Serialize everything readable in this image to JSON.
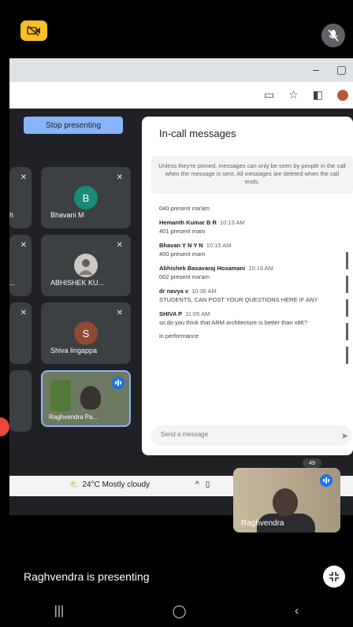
{
  "meeting": {
    "stop_presenting": "Stop presenting",
    "tiles": [
      {
        "name": "Bhavani M",
        "initial": "B",
        "avatar_color": "#1a8a7a"
      },
      {
        "name": "ABHISHEK KU...",
        "initial": "",
        "avatar_color": "#c9c9c9"
      },
      {
        "name": "Shiva lingappa",
        "initial": "S",
        "avatar_color": "#8f4a33"
      }
    ],
    "left_tiles": [
      {
        "name": "h"
      },
      {
        "name": "..."
      }
    ],
    "presenter_tile_name": "Raghvendra Pa..."
  },
  "chat": {
    "title": "In-call messages",
    "notice": "Unless they're pinned, messages can only be seen by people in the call when the message is sent. All messages are deleted when the call ends.",
    "messages": [
      {
        "sender": "",
        "time": "",
        "text": "040 present ma'am"
      },
      {
        "sender": "Hemanth Kumar B R",
        "time": "10:13 AM",
        "text": "401 present mam"
      },
      {
        "sender": "Bhavan Y N Y N",
        "time": "10:15 AM",
        "text": "400 present mam"
      },
      {
        "sender": "Abhishek Basavaraj Hosamani",
        "time": "10:16 AM",
        "text": "002 present ma'am"
      },
      {
        "sender": "dr navya v",
        "time": "10:36 AM",
        "text": "STUDENTS, CAN POST YOUR QUESTIONS HERE IF ANY"
      },
      {
        "sender": "SHIVA P",
        "time": "11:05 AM",
        "text": "sir,do you think that ARM architecture is better than x86?"
      },
      {
        "sender": "",
        "time": "",
        "text": "in performance"
      }
    ],
    "input_placeholder": "Send a message"
  },
  "taskbar": {
    "weather": "24°C Mostly cloudy"
  },
  "self_view": {
    "name": "Raghvendra",
    "count": "49"
  },
  "status": {
    "presenting": "Raghvendra is presenting"
  },
  "colors": {
    "accent": "#8ab4f8",
    "meet_bg": "#202124",
    "tile_bg": "#3c4043",
    "camoff": "#f6c026"
  }
}
